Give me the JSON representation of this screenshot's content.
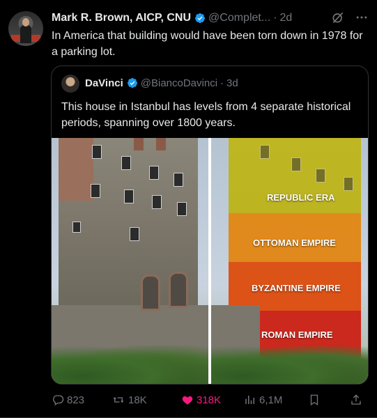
{
  "tweet": {
    "author_name": "Mark R. Brown, AICP, CNU",
    "handle": "@Complet...",
    "separator": "·",
    "time": "2d",
    "text": "In America that building would have been torn down in 1978 for a parking lot."
  },
  "quote": {
    "author_name": "DaVinci",
    "handle": "@BiancoDavinci",
    "separator": "·",
    "time": "3d",
    "text": "This house in Istanbul has levels from 4 separate historical periods, spanning over 1800 years.",
    "image_labels": {
      "republic": "REPUBLIC ERA",
      "ottoman": "OTTOMAN EMPIRE",
      "byzantine": "BYZANTINE EMPIRE",
      "roman": "ROMAN EMPIRE"
    }
  },
  "actions": {
    "replies": "823",
    "reposts": "18K",
    "likes": "318K",
    "views": "6,1M"
  },
  "colors": {
    "background": "#000000",
    "text": "#e7e9ea",
    "muted": "#71767b",
    "verified": "#1d9bf0",
    "like": "#f91880",
    "border": "#2f3336"
  },
  "icons": [
    "verified-badge-icon",
    "grok-icon",
    "more-icon",
    "reply-icon",
    "repost-icon",
    "like-icon",
    "views-icon",
    "bookmark-icon",
    "share-icon"
  ]
}
